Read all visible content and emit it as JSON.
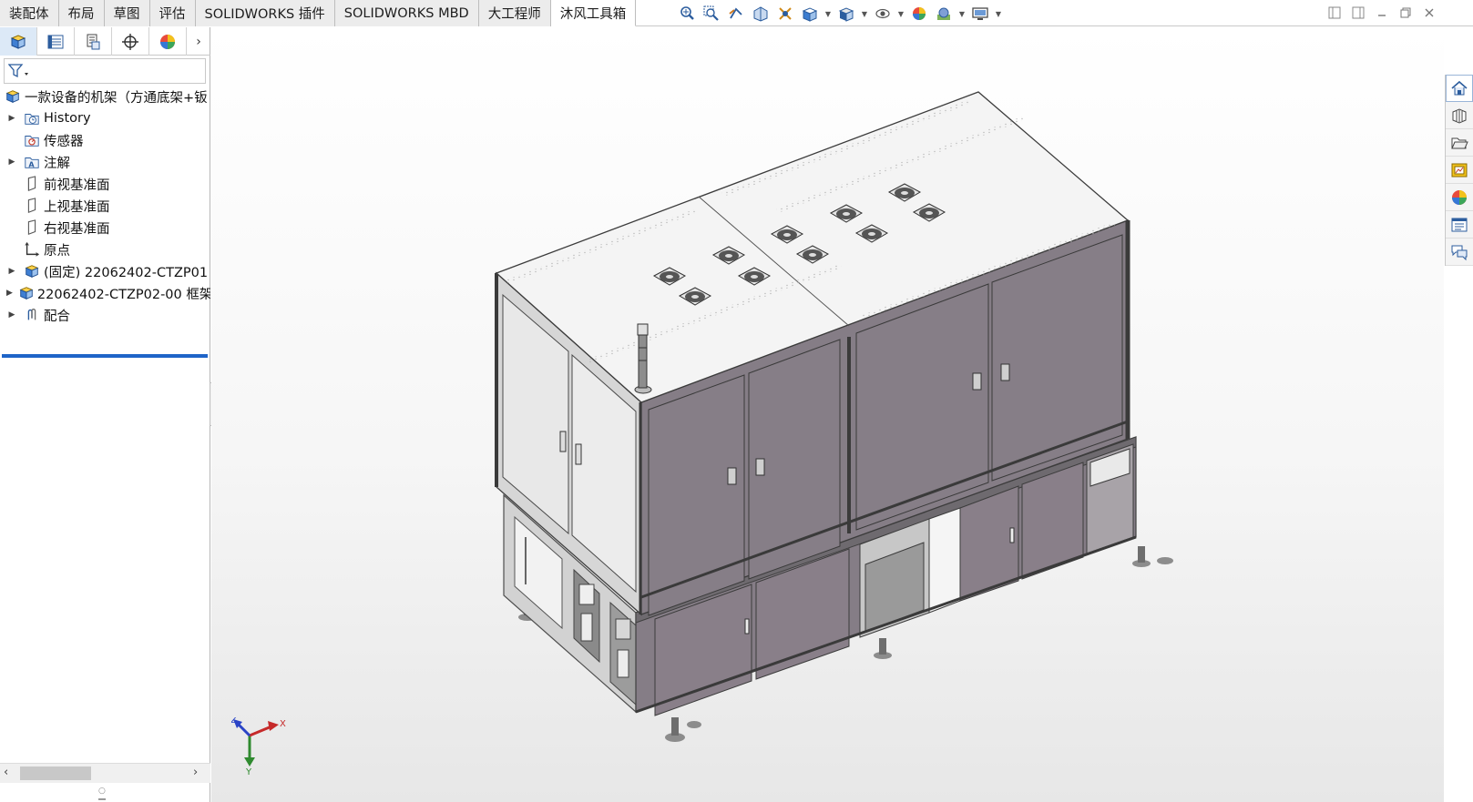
{
  "tabs": [
    "装配体",
    "布局",
    "草图",
    "评估",
    "SOLIDWORKS 插件",
    "SOLIDWORKS MBD",
    "大工程师",
    "沐风工具箱"
  ],
  "active_tab_index": 7,
  "feature_tree": {
    "root": "一款设备的机架（方通底架+钣",
    "items": [
      {
        "label": "History",
        "expandable": true,
        "icon": "history-folder-icon"
      },
      {
        "label": "传感器",
        "expandable": false,
        "icon": "sensor-icon"
      },
      {
        "label": "注解",
        "expandable": true,
        "icon": "annotation-icon"
      },
      {
        "label": "前视基准面",
        "expandable": false,
        "icon": "plane-icon"
      },
      {
        "label": "上视基准面",
        "expandable": false,
        "icon": "plane-icon"
      },
      {
        "label": "右视基准面",
        "expandable": false,
        "icon": "plane-icon"
      },
      {
        "label": "原点",
        "expandable": false,
        "icon": "origin-icon"
      },
      {
        "label": "(固定) 22062402-CTZP01",
        "expandable": true,
        "icon": "subassembly-icon"
      },
      {
        "label": "22062402-CTZP02-00 框架",
        "expandable": true,
        "icon": "subassembly-icon"
      },
      {
        "label": "配合",
        "expandable": true,
        "icon": "mates-icon"
      }
    ]
  },
  "triad": {
    "x": "X",
    "y": "Y",
    "z": "Z"
  },
  "colors": {
    "accent": "#1e64c8",
    "panel": "#857d86",
    "frame": "#7a7a7a",
    "top": "#f4f4f4"
  }
}
